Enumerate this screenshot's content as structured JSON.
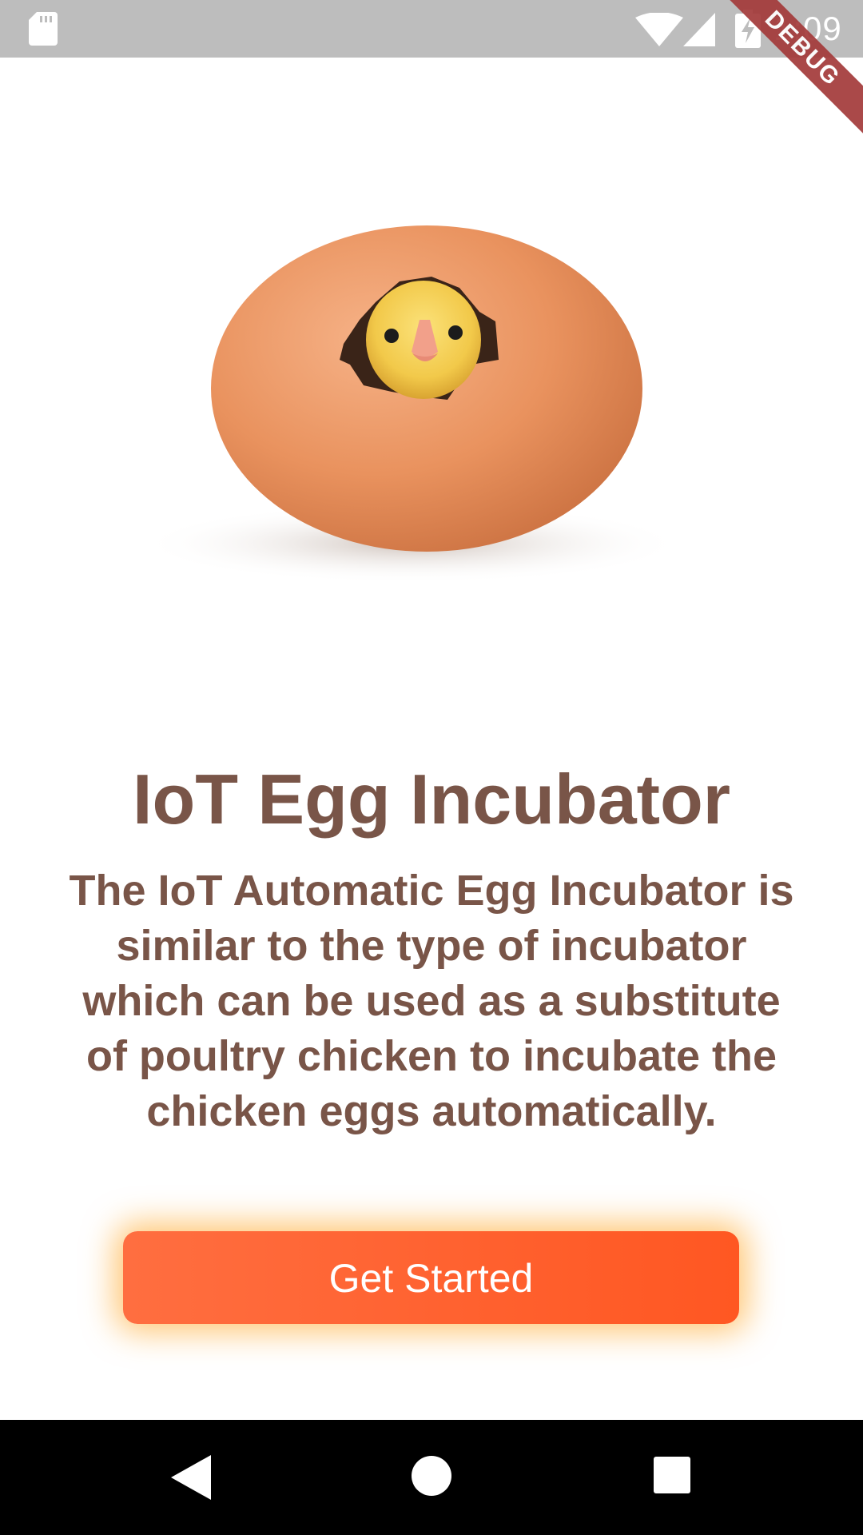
{
  "status_bar": {
    "time": "1:09",
    "icons": [
      "sd-card-icon",
      "wifi-icon",
      "cell-signal-icon",
      "battery-charging-icon"
    ]
  },
  "debug_banner": {
    "label": "DEBUG"
  },
  "hero": {
    "image": "egg-with-hatching-chick"
  },
  "title": "IoT Egg Incubator",
  "description": "The IoT Automatic Egg Incubator is similar to the type of incubator which can be used as a substitute of poultry chicken to incubate the chicken eggs automatically.",
  "cta": {
    "label": "Get Started"
  },
  "nav_bar": {
    "icons": [
      "back-icon",
      "home-icon",
      "recents-icon"
    ]
  },
  "colors": {
    "text_brown": "#795548",
    "button_start": "#ff6e40",
    "button_end": "#ff5722",
    "button_glow": "#ff9800",
    "status_bar": "#bdbdbd",
    "nav_bar": "#000000"
  }
}
